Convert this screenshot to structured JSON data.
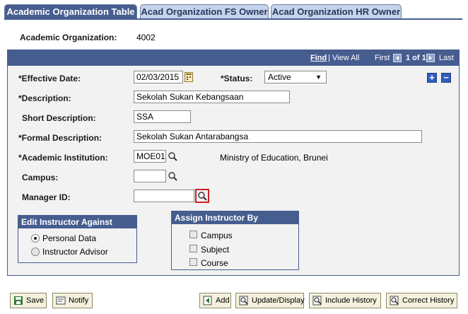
{
  "tabs": [
    {
      "label": "Academic Organization Table"
    },
    {
      "label": "Acad Organization FS Owner"
    },
    {
      "label": "Acad Organization HR Owner"
    }
  ],
  "header": {
    "acad_org_label": "Academic Organization:",
    "acad_org_value": "4002"
  },
  "nav": {
    "find": "Find",
    "sep": "|",
    "view_all": "View All",
    "first": "First",
    "of": "1 of 1",
    "last": "Last"
  },
  "form": {
    "effective_date_label": "*Effective Date:",
    "effective_date_value": "02/03/2015",
    "status_label": "*Status:",
    "status_value": "Active",
    "description_label": "*Description:",
    "description_value": "Sekolah Sukan Kebangsaan",
    "short_desc_label": "Short Description:",
    "short_desc_value": "SSA",
    "formal_desc_label": "*Formal Description:",
    "formal_desc_value": "Sekolah Sukan Antarabangsa",
    "institution_label": "*Academic Institution:",
    "institution_value": "MOE01",
    "institution_desc": "Ministry of Education, Brunei",
    "campus_label": "Campus:",
    "campus_value": "",
    "manager_label": "Manager ID:",
    "manager_value": ""
  },
  "edit_instructor": {
    "title": "Edit Instructor Against",
    "options": [
      "Personal Data",
      "Instructor Advisor"
    ],
    "selected": "Personal Data"
  },
  "assign_instructor": {
    "title": "Assign Instructor By",
    "options": [
      "Campus",
      "Subject",
      "Course"
    ]
  },
  "toolbar": {
    "save": "Save",
    "notify": "Notify",
    "add": "Add",
    "update": "Update/Display",
    "include_history": "Include History",
    "correct_history": "Correct History"
  },
  "colors": {
    "header_blue": "#465d8f",
    "tab_inactive": "#c6d3ea",
    "highlight_red": "#d0202a"
  }
}
